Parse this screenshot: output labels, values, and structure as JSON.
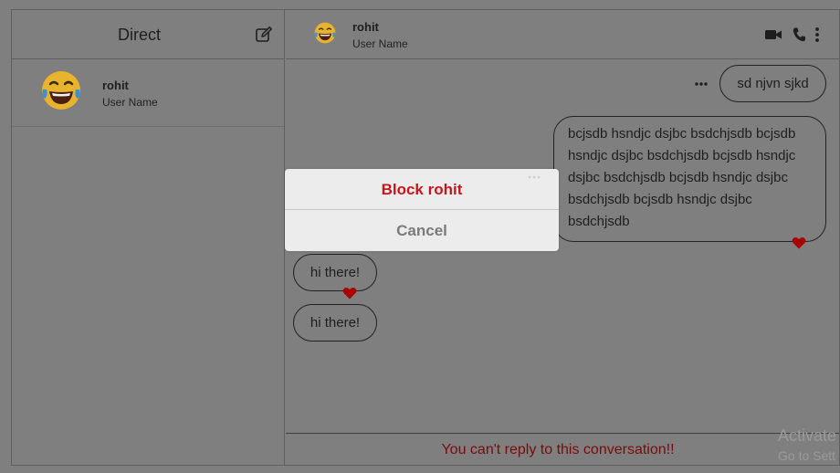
{
  "sidebar": {
    "title": "Direct",
    "compose_icon": "edit-icon",
    "conversations": [
      {
        "name": "rohit",
        "subtitle": "User Name",
        "avatar": "laughing-emoji"
      }
    ]
  },
  "chat": {
    "contact_name": "rohit",
    "contact_subtitle": "User Name",
    "header_icons": [
      "video-call-icon",
      "phone-icon",
      "more-vertical-icon"
    ],
    "messages": [
      {
        "text": "sd njvn sjkd",
        "side": "right",
        "liked": false
      },
      {
        "text": "bcjsdb hsndjc dsjbc bsdchjsdb bcjsdb hsndjc dsjbc bsdchjsdb bcjsdb hsndjc dsjbc bsdchjsdb bcjsdb hsndjc dsjbc bsdchjsdb bcjsdb hsndjc dsjbc bsdchjsdb",
        "side": "right",
        "liked": true
      },
      {
        "text": "hi there!",
        "side": "left",
        "liked": true
      },
      {
        "text": "hi there!",
        "side": "left",
        "liked": false
      }
    ],
    "footer_notice": "You can't reply to this conversation!!"
  },
  "modal": {
    "block_label": "Block rohit",
    "cancel_label": "Cancel"
  },
  "watermark": {
    "line1": "Activate",
    "line2": "Go to Sett"
  },
  "colors": {
    "overlay": "#7f7f7f",
    "danger": "#c4161c",
    "heart": "#a80000",
    "footer_text": "#7a0b0b"
  }
}
